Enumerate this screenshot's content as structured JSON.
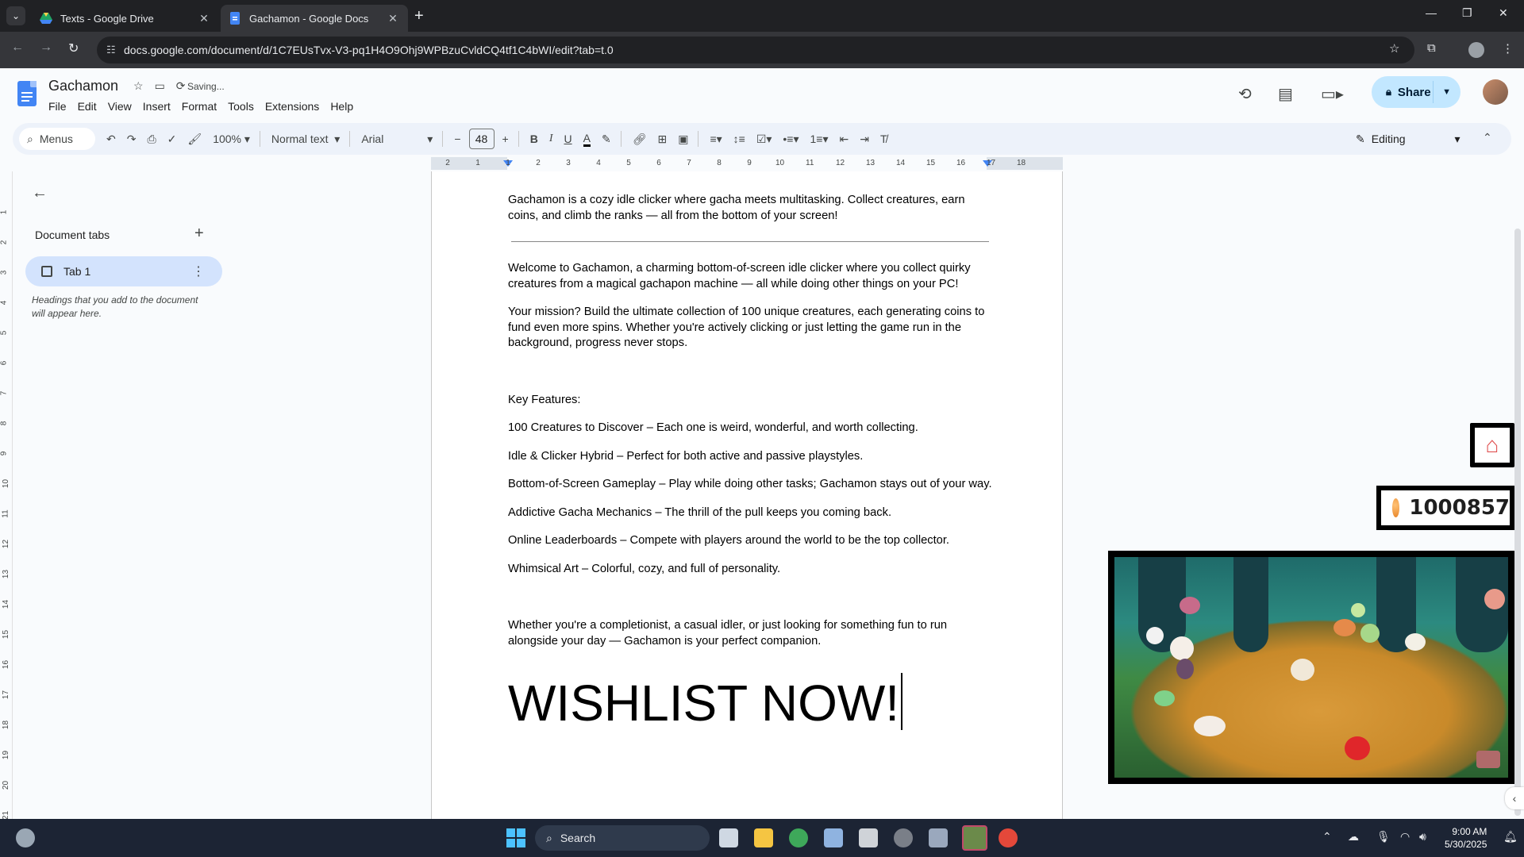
{
  "browser": {
    "tabs": [
      {
        "title": "Texts - Google Drive",
        "active": false
      },
      {
        "title": "Gachamon - Google Docs",
        "active": true
      }
    ],
    "url": "docs.google.com/document/d/1C7EUsTvx-V3-pq1H4O9Ohj9WPBzuCvldCQ4tf1C4bWI/edit?tab=t.0"
  },
  "docs": {
    "title": "Gachamon",
    "status": "Saving...",
    "menu": [
      "File",
      "Edit",
      "View",
      "Insert",
      "Format",
      "Tools",
      "Extensions",
      "Help"
    ],
    "share_label": "Share"
  },
  "toolbar": {
    "menus_label": "Menus",
    "zoom": "100%",
    "style": "Normal text",
    "font": "Arial",
    "font_size": "48",
    "mode": "Editing"
  },
  "ruler": {
    "h_ticks": [
      "2",
      "1",
      "1",
      "2",
      "3",
      "4",
      "5",
      "6",
      "7",
      "8",
      "9",
      "10",
      "11",
      "12",
      "13",
      "14",
      "15",
      "16",
      "17",
      "18"
    ],
    "v_ticks": [
      "1",
      "2",
      "3",
      "4",
      "5",
      "6",
      "7",
      "8",
      "9",
      "10",
      "11",
      "12",
      "13",
      "14",
      "15",
      "16",
      "17",
      "18",
      "19",
      "20",
      "21"
    ]
  },
  "sidebar": {
    "heading": "Document tabs",
    "tab_label": "Tab 1",
    "hint": "Headings that you add to the document will appear here."
  },
  "document": {
    "tagline": "Gachamon is a cozy idle clicker where gacha meets multitasking. Collect creatures, earn coins, and climb the ranks — all from the bottom of your screen!",
    "intro": "Welcome to Gachamon, a charming bottom-of-screen idle clicker where you collect quirky creatures from a magical gachapon machine — all while doing other things on your PC!",
    "mission": "Your mission? Build the ultimate collection of 100 unique creatures, each generating coins to fund even more spins. Whether you're actively clicking or just letting the game run in the background, progress never stops.",
    "features_heading": "Key Features:",
    "features": [
      "100 Creatures to Discover – Each one is weird, wonderful, and worth collecting.",
      "Idle & Clicker Hybrid – Perfect for both active and passive playstyles.",
      "Bottom-of-Screen Gameplay – Play while doing other tasks; Gachamon stays out of your way.",
      "Addictive Gacha Mechanics – The thrill of the pull keeps you coming back.",
      "Online Leaderboards – Compete with players around the world to be the top collector.",
      "Whimsical Art – Colorful, cozy, and full of personality."
    ],
    "closing": "Whether you're a completionist, a casual idler, or just looking for something fun to run alongside your day — Gachamon is your perfect companion.",
    "cta": "WISHLIST NOW!"
  },
  "game_overlay": {
    "coins": "1000857"
  },
  "taskbar": {
    "search_label": "Search",
    "time": "9:00 AM",
    "date": "5/30/2025"
  },
  "colors": {
    "share_bg": "#c2e7ff",
    "tab_selected_bg": "#d3e3fd",
    "toolbar_bg": "#edf2fa",
    "taskbar_bg": "#1c2434"
  }
}
